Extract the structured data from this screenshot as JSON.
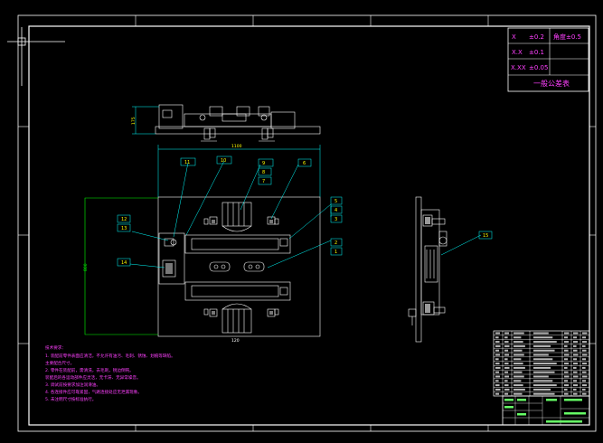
{
  "drawing": {
    "tolerance_table": {
      "rows": [
        [
          "X",
          "±0.2",
          "角度±0.5"
        ],
        [
          "X.X",
          "±0.1",
          ""
        ],
        [
          "X.XX",
          "±0.05",
          ""
        ]
      ],
      "title": "一般公差表"
    },
    "balloons": [
      "11",
      "10",
      "9",
      "8",
      "7",
      "6",
      "5",
      "4",
      "3",
      "2",
      "1",
      "12",
      "13",
      "14",
      "15"
    ],
    "dimensions": {
      "top_width": "1100",
      "side_height": "175",
      "front_height": "800",
      "bottom_dim": "120"
    },
    "notes": [
      "技术要求：",
      "1. 装配前零件表面应清洁，不允许有油污、毛刺、锈蚀、划痕等缺陷。",
      "主要配合尺寸。",
      "2. 零件在装配前，需清洗，去毛刺，锐边倒钝。",
      "装配后的各运动部件应灵活，无卡滞、无异常噪音。",
      "3. 调试前按要求加注润滑油。",
      "4. 各连接件应可靠紧固，气路连接处应无泄漏现象。",
      "5. 未注明尺寸按标准执行。"
    ]
  }
}
